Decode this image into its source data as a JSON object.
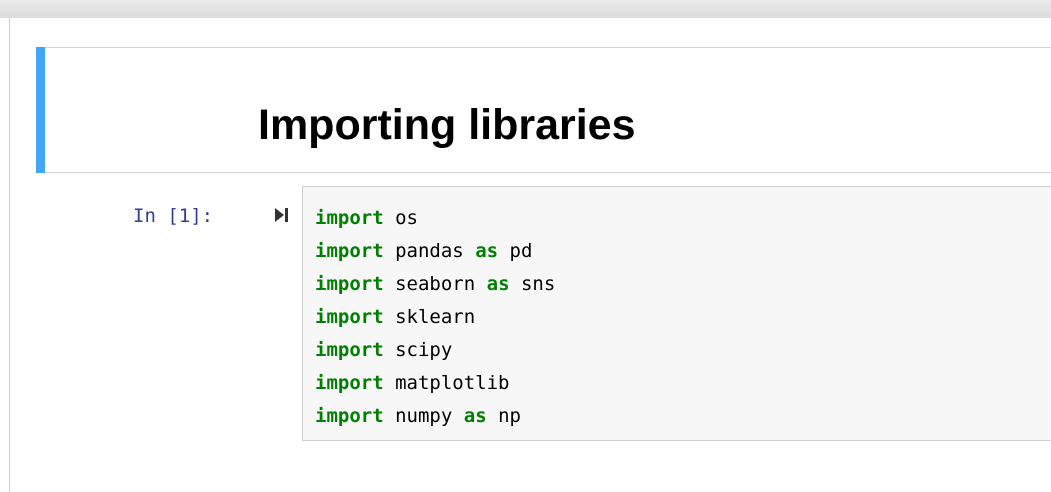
{
  "notebook": {
    "markdown_cell": {
      "heading": "Importing libraries"
    },
    "code_cell": {
      "prompt": "In [1]:",
      "run_icon": "run-cell-icon",
      "lines": [
        {
          "keyword": "import",
          "module": "os",
          "alias_keyword": "",
          "alias": ""
        },
        {
          "keyword": "import",
          "module": "pandas",
          "alias_keyword": "as",
          "alias": "pd"
        },
        {
          "keyword": "import",
          "module": "seaborn",
          "alias_keyword": "as",
          "alias": "sns"
        },
        {
          "keyword": "import",
          "module": "sklearn",
          "alias_keyword": "",
          "alias": ""
        },
        {
          "keyword": "import",
          "module": "scipy",
          "alias_keyword": "",
          "alias": ""
        },
        {
          "keyword": "import",
          "module": "matplotlib",
          "alias_keyword": "",
          "alias": ""
        },
        {
          "keyword": "import",
          "module": "numpy",
          "alias_keyword": "as",
          "alias": "np"
        }
      ]
    }
  },
  "colors": {
    "selected_cell_bar": "#42a5f5",
    "prompt": "#303f9f",
    "keyword": "#008000"
  }
}
